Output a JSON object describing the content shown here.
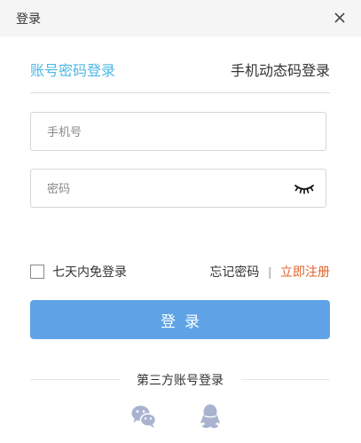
{
  "window": {
    "title": "登录",
    "close_icon": "close-icon"
  },
  "tabs": {
    "active": "账号密码登录",
    "other": "手机动态码登录"
  },
  "form": {
    "phone_placeholder": "手机号",
    "phone_value": "",
    "password_placeholder": "密码",
    "password_value": "",
    "password_toggle_icon": "eye-closed-icon"
  },
  "options": {
    "remember_label": "七天内免登录",
    "remember_checked": false,
    "forgot_label": "忘记密码",
    "separator": "|",
    "register_label": "立即注册"
  },
  "login_button": {
    "label": "登录"
  },
  "third_party": {
    "label": "第三方账号登录",
    "providers": [
      "wechat-icon",
      "qq-icon"
    ]
  },
  "colors": {
    "accent": "#4cb8e6",
    "button": "#5fa3e6",
    "register_link": "#e0632b",
    "social_icon": "#a9b3cf"
  }
}
